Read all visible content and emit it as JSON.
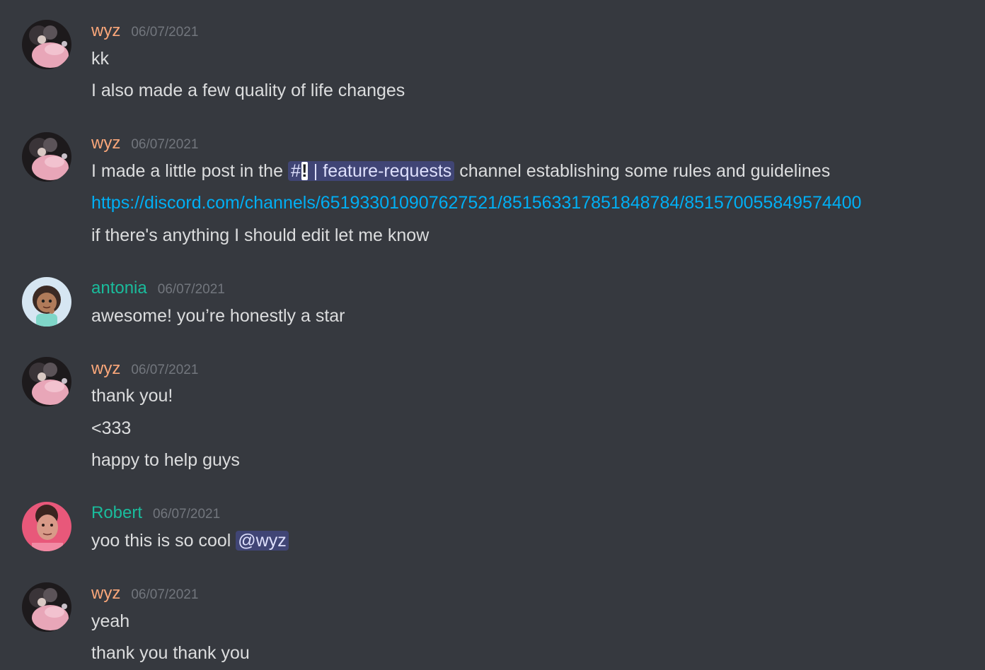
{
  "colors": {
    "background": "#36393f",
    "text": "#dcddde",
    "timestamp": "#72767d",
    "link": "#00aff4",
    "wyz": "#faa77a",
    "antonia": "#1abc9c",
    "robert": "#1abc9c",
    "mention_bg": "#4a4f85"
  },
  "messages": [
    {
      "author": "wyz",
      "timestamp": "06/07/2021",
      "avatar": "wyz-avatar",
      "lines": [
        "kk",
        "I also made a few quality of life changes"
      ]
    },
    {
      "author": "wyz",
      "timestamp": "06/07/2021",
      "avatar": "wyz-avatar",
      "line1_before": "I made a little post in the",
      "channel_hash": "#",
      "channel_bang": "!",
      "channel_sep": "|",
      "channel_name": "feature-requests",
      "line1_after": "channel establishing some rules and guidelines",
      "link": "https://discord.com/channels/651933010907627521/851563317851848784/851570055849574400",
      "line3": "if there's anything I should edit let me know"
    },
    {
      "author": "antonia",
      "timestamp": "06/07/2021",
      "avatar": "antonia-avatar",
      "lines": [
        "awesome! you’re honestly a star"
      ]
    },
    {
      "author": "wyz",
      "timestamp": "06/07/2021",
      "avatar": "wyz-avatar",
      "lines": [
        "thank you!",
        "<333",
        "happy to help guys"
      ]
    },
    {
      "author": "Robert",
      "timestamp": "06/07/2021",
      "avatar": "robert-avatar",
      "line_before": "yoo this is so cool",
      "mention": "@wyz"
    },
    {
      "author": "wyz",
      "timestamp": "06/07/2021",
      "avatar": "wyz-avatar",
      "lines": [
        "yeah",
        "thank you thank you"
      ]
    }
  ]
}
